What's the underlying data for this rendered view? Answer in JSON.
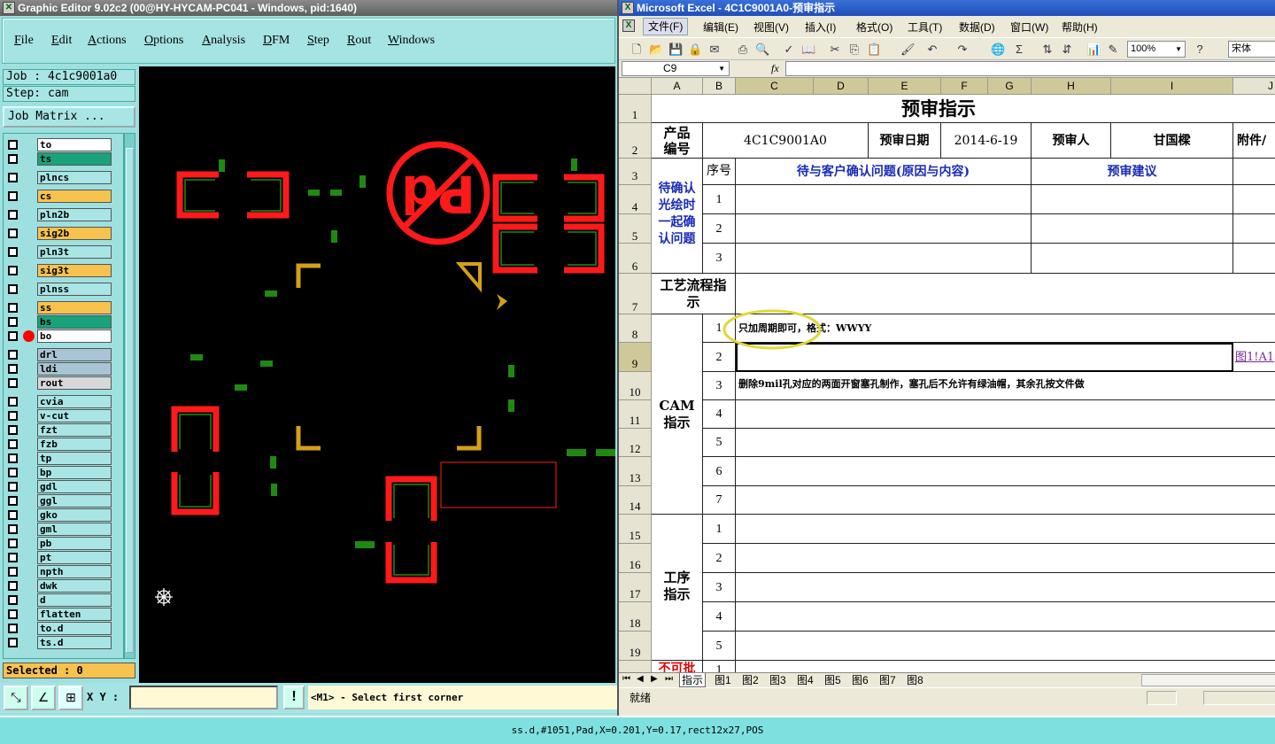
{
  "graphic_editor": {
    "title": "Graphic Editor 9.02c2 (00@HY-HYCAM-PC041 - Windows, pid:1640)",
    "menu": [
      "File",
      "Edit",
      "Actions",
      "Options",
      "Analysis",
      "DFM",
      "Step",
      "Rout",
      "Windows"
    ],
    "job_label": "Job : 4c1c9001a0",
    "step_label": "Step: cam",
    "job_matrix_button": "Job Matrix ...",
    "layers": [
      {
        "name": "to",
        "color": "#ffffff"
      },
      {
        "name": "ts",
        "color": "#1aa37a"
      },
      {
        "name": "plncs",
        "color": "#a9e5e5"
      },
      {
        "name": "cs",
        "color": "#f7c24e"
      },
      {
        "name": "pln2b",
        "color": "#a9e5e5"
      },
      {
        "name": "sig2b",
        "color": "#f7c24e"
      },
      {
        "name": "pln3t",
        "color": "#a9e5e5"
      },
      {
        "name": "sig3t",
        "color": "#f7c24e"
      },
      {
        "name": "plnss",
        "color": "#a9e5e5"
      },
      {
        "name": "ss",
        "color": "#f7c24e"
      },
      {
        "name": "bs",
        "color": "#1aa37a"
      },
      {
        "name": "bo",
        "color": "#ffffff",
        "active": true
      },
      {
        "name": "drl",
        "color": "#a9c4d4"
      },
      {
        "name": "ldi",
        "color": "#a9c4d4"
      },
      {
        "name": "rout",
        "color": "#d8d8d8"
      },
      {
        "name": "cvia",
        "color": "#a9e5e5"
      },
      {
        "name": "v-cut",
        "color": "#a9e5e5"
      },
      {
        "name": "fzt",
        "color": "#a9e5e5"
      },
      {
        "name": "fzb",
        "color": "#a9e5e5"
      },
      {
        "name": "tp",
        "color": "#a9e5e5"
      },
      {
        "name": "bp",
        "color": "#a9e5e5"
      },
      {
        "name": "gdl",
        "color": "#a9e5e5"
      },
      {
        "name": "ggl",
        "color": "#a9e5e5"
      },
      {
        "name": "gko",
        "color": "#a9e5e5"
      },
      {
        "name": "gml",
        "color": "#a9e5e5"
      },
      {
        "name": "pb",
        "color": "#a9e5e5"
      },
      {
        "name": "pt",
        "color": "#a9e5e5"
      },
      {
        "name": "npth",
        "color": "#a9e5e5"
      },
      {
        "name": "dwk",
        "color": "#a9e5e5"
      },
      {
        "name": "d",
        "color": "#a9e5e5"
      },
      {
        "name": "flatten",
        "color": "#a9e5e5"
      },
      {
        "name": "to.d",
        "color": "#a9e5e5"
      },
      {
        "name": "ts.d",
        "color": "#a9e5e5"
      }
    ],
    "selected": "Selected : 0",
    "xy_label": "X Y :",
    "xy_value": "",
    "hint": "<M1> - Select first corner",
    "hint_button": "!",
    "colors": {
      "pad_red": "#ff1a1a",
      "trace_green": "#1f8a10",
      "marker_gold": "#d4a017"
    }
  },
  "excel": {
    "title": "Microsoft Excel - 4C1C9001A0-预审指示",
    "menu": [
      "文件(F)",
      "编辑(E)",
      "视图(V)",
      "插入(I)",
      "格式(O)",
      "工具(T)",
      "数据(D)",
      "窗口(W)",
      "帮助(H)"
    ],
    "zoom": "100%",
    "font": "宋体",
    "name_box": "C9",
    "fx_label": "fx",
    "columns": [
      "A",
      "B",
      "C",
      "D",
      "E",
      "F",
      "G",
      "H",
      "I",
      "J"
    ],
    "rows": [
      "1",
      "2",
      "3",
      "4",
      "5",
      "6",
      "7",
      "8",
      "9",
      "10",
      "11",
      "12",
      "13",
      "14",
      "15",
      "16",
      "17",
      "18",
      "19"
    ],
    "sheet": {
      "title": "预审指示",
      "product_no_label": "产品编号",
      "product_no": "4C1C9001A0",
      "review_date_label": "预审日期",
      "review_date": "2014-6-19",
      "reviewer_label": "预审人",
      "reviewer": "甘国樑",
      "attachment_label": "附件/",
      "seq_label": "序号",
      "issues_header": "待与客户确认问题(原因与内容)",
      "advice_header": "预审建议",
      "confirm_section": "待确认光绘时一起确认问题",
      "process_flow": "工艺流程指示",
      "cam_section": "CAM指示",
      "cam_note_1": "只加周期即可，格式：WWYY",
      "cam_note_3": "删除9mil孔对应的两面开窗塞孔制作，塞孔后不允许有绿油帽，其余孔按文件做",
      "link_text": "图1!A1",
      "process_section": "工序指示",
      "bottom_partial": "不可批",
      "nums": [
        "1",
        "2",
        "3",
        "4",
        "5",
        "6",
        "7"
      ]
    },
    "sheet_tabs": [
      "指示",
      "图1",
      "图2",
      "图3",
      "图4",
      "图5",
      "图6",
      "图7",
      "图8"
    ],
    "status": "就绪"
  },
  "status_bar": "ss.d,#1051,Pad,X=0.201,Y=0.17,rect12x27,POS"
}
